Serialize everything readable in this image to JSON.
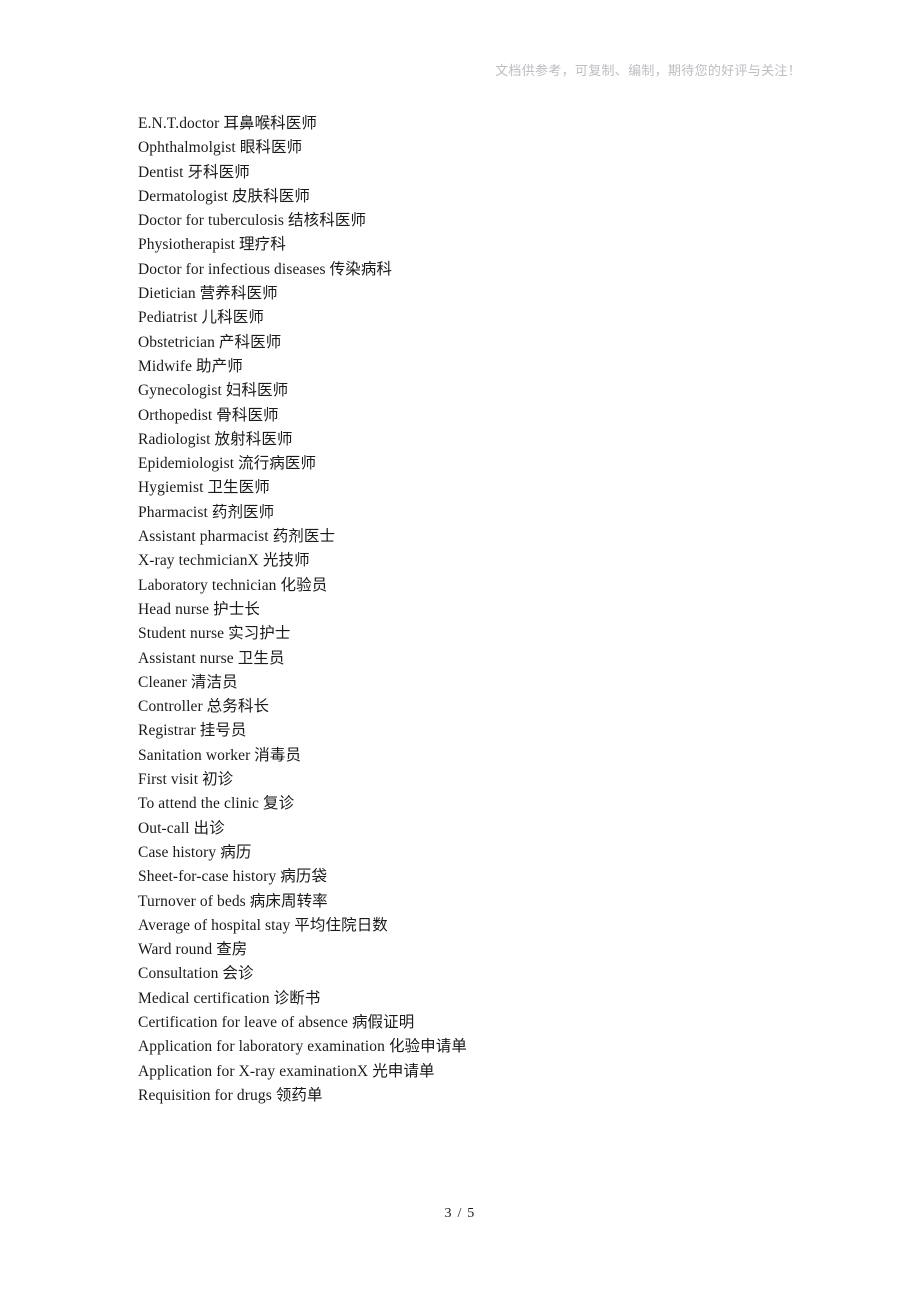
{
  "header": {
    "watermark": "文档供参考，可复制、编制，期待您的好评与关注！"
  },
  "document": {
    "lines": [
      "E.N.T.doctor 耳鼻喉科医师",
      "Ophthalmolgist 眼科医师",
      "Dentist 牙科医师",
      "Dermatologist 皮肤科医师",
      "Doctor for tuberculosis 结核科医师",
      "Physiotherapist 理疗科",
      "Doctor for infectious diseases 传染病科",
      "Dietician 营养科医师",
      "Pediatrist 儿科医师",
      "Obstetrician 产科医师",
      "Midwife 助产师",
      "Gynecologist 妇科医师",
      "Orthopedist 骨科医师",
      "Radiologist 放射科医师",
      "Epidemiologist 流行病医师",
      "Hygiemist 卫生医师",
      "Pharmacist 药剂医师",
      "Assistant pharmacist 药剂医士",
      "X-ray techmicianX 光技师",
      "Laboratory technician 化验员",
      "Head nurse 护士长",
      "Student nurse 实习护士",
      "Assistant nurse 卫生员",
      "Cleaner 清洁员",
      "Controller 总务科长",
      "Registrar 挂号员",
      "Sanitation worker 消毒员",
      "First visit 初诊",
      "To attend the clinic 复诊",
      "Out-call 出诊",
      "Case history 病历",
      "Sheet-for-case history 病历袋",
      "Turnover of beds 病床周转率",
      "Average of hospital stay 平均住院日数",
      "Ward round 查房",
      "Consultation 会诊",
      "Medical certification 诊断书",
      "Certification for leave of absence 病假证明",
      "Application for laboratory examination 化验申请单",
      "Application for X-ray examinationX 光申请单",
      "Requisition for drugs 领药单"
    ]
  },
  "footer": {
    "page_indicator": "3 / 5"
  },
  "colors": {
    "watermark": "#bdbdc2",
    "body_text": "#1a1a1a",
    "page_background": "#ffffff"
  }
}
